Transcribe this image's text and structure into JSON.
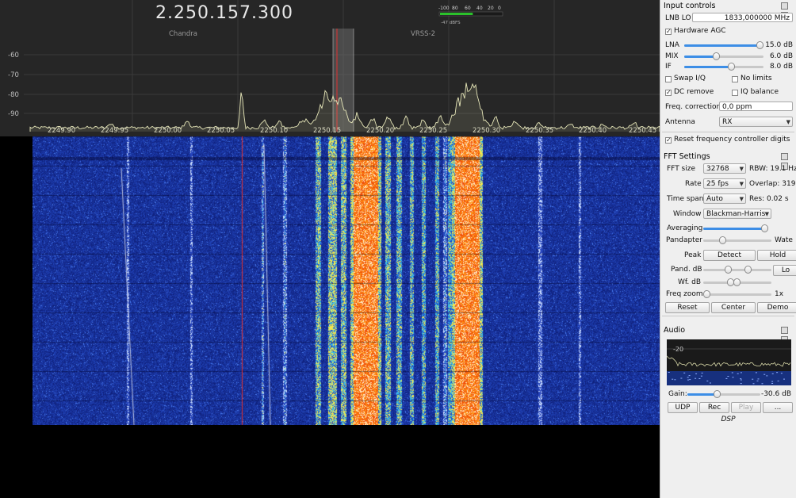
{
  "main": {
    "frequency": "2.250.157.300",
    "bookmarks": [
      "Chandra",
      "VRSS-2"
    ],
    "db_labels": [
      "-60",
      "-70",
      "-80",
      "-90"
    ],
    "freq_labels": [
      "2249.90",
      "2249.95",
      "2250.00",
      "2250.05",
      "2250.10",
      "2250.15",
      "2250.20",
      "2250.25",
      "2250.30",
      "2250.35",
      "2250.40",
      "2250.45"
    ],
    "meter": {
      "scale": [
        "-100",
        "80",
        "60",
        "40",
        "20",
        "0"
      ],
      "reading": "-47 dBFS",
      "level": 0.53
    }
  },
  "input_controls": {
    "title": "Input controls",
    "lnb_lo_label": "LNB LO",
    "lnb_lo_value": "1833,000000 MHz",
    "hardware_agc_label": "Hardware AGC",
    "gains": [
      {
        "label": "LNA",
        "value": "15.0 dB",
        "level": 1.0
      },
      {
        "label": "MIX",
        "value": "6.0 dB",
        "level": 0.4
      },
      {
        "label": "IF",
        "value": "8.0 dB",
        "level": 0.6
      }
    ],
    "swap_iq_label": "Swap I/Q",
    "no_limits_label": "No limits",
    "dc_remove_label": "DC remove",
    "iq_balance_label": "IQ balance",
    "freq_correction_label": "Freq. correction",
    "freq_correction_value": "0,0 ppm",
    "antenna_label": "Antenna",
    "antenna_value": "RX",
    "reset_digits_label": "Reset frequency controller digits"
  },
  "fft_settings": {
    "title": "FFT Settings",
    "fft_size_label": "FFT size",
    "fft_size_value": "32768",
    "rbw_label": "RBW: 19.1 Hz",
    "rate_label": "Rate",
    "rate_value": "25 fps",
    "overlap_label": "Overlap: 319",
    "time_span_label": "Time span",
    "time_span_value": "Auto",
    "res_label": "Res: 0.02 s",
    "window_label": "Window",
    "window_value": "Blackman-Harris",
    "averaging_label": "Averaging",
    "pandapter_label": "Pandapter",
    "pandapter_right": "Wate",
    "peak_label": "Peak",
    "detect_label": "Detect",
    "hold_label": "Hold",
    "pand_db_label": "Pand. dB",
    "lock_label": "Lo",
    "wf_db_label": "Wf. dB",
    "freq_zoom_label": "Freq zoom",
    "freq_zoom_value": "1x",
    "reset_label": "Reset",
    "center_label": "Center",
    "demod_label": "Demo"
  },
  "audio": {
    "title": "Audio",
    "fft_label": "-20",
    "gain_label": "Gain:",
    "gain_value": "-30.6 dB",
    "gain_level": 0.4,
    "udp_label": "UDP",
    "rec_label": "Rec",
    "play_label": "Play",
    "more_label": "...",
    "dsp_label": "DSP"
  },
  "colors": {
    "pandapter_bg": "#262626",
    "trace": "#e6e6b8",
    "waterfall_low": "#102ca0",
    "waterfall_high": "#ff6a00",
    "tuning_line": "#e03030",
    "accent": "#3d8ee6"
  }
}
